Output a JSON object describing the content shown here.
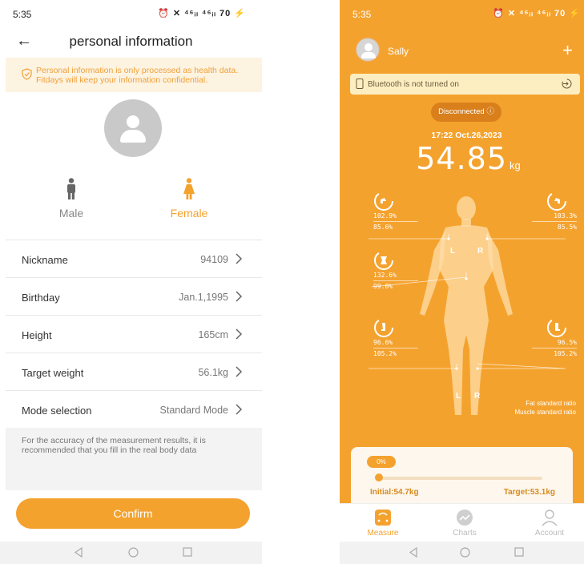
{
  "left": {
    "status_time": "5:35",
    "status_icons": "⏰ ✕ ⁴⁶ᵢₗ ⁴⁶ᵢₗ 70 ⚡",
    "title": "personal information",
    "notice": "Personal information is only processed as health data. Fitdays will keep your information confidential.",
    "gender": {
      "male": "Male",
      "female": "Female",
      "selected": "Female"
    },
    "rows": [
      {
        "label": "Nickname",
        "value": "94109"
      },
      {
        "label": "Birthday",
        "value": "Jan.1,1995"
      },
      {
        "label": "Height",
        "value": "165cm"
      },
      {
        "label": "Target weight",
        "value": "56.1kg"
      },
      {
        "label": "Mode selection",
        "value": "Standard Mode"
      }
    ],
    "tip": "For the accuracy of the measurement results, it is recommended that you fill in the real body data",
    "confirm": "Confirm"
  },
  "right": {
    "status_time": "5:35",
    "status_icons": "⏰ ✕ ⁴⁶ᵢₗ ⁴⁶ᵢₗ 70 ⚡",
    "user_name": "Sally",
    "bluetooth_notice": "Bluetooth is not turned on",
    "connection_status": "Disconnected ⓘ",
    "measure_time": "17:22 Oct.26,2023",
    "weight_value": "54.85",
    "weight_unit": "kg",
    "segments": {
      "left_arm": {
        "fat": "102.9%",
        "muscle": "85.6%"
      },
      "right_arm": {
        "fat": "103.3%",
        "muscle": "85.5%"
      },
      "trunk": {
        "fat": "132.6%",
        "muscle": "99.0%"
      },
      "left_leg": {
        "fat": "96.6%",
        "muscle": "105.2%"
      },
      "right_leg": {
        "fat": "96.5%",
        "muscle": "105.2%"
      }
    },
    "side_labels": {
      "left": "L",
      "right": "R"
    },
    "legend": {
      "fat": "Fat standard ratio",
      "muscle": "Muscle standard ratio"
    },
    "progress": {
      "percent_label": "0%",
      "fraction": 0.0,
      "initial": "Initial:54.7kg",
      "target": "Target:53.1kg"
    },
    "tabs": [
      {
        "label": "Measure",
        "active": true
      },
      {
        "label": "Charts",
        "active": false
      },
      {
        "label": "Account",
        "active": false
      }
    ],
    "colors": {
      "accent": "#f4a22e",
      "background": "#f4a22e",
      "notice_bg": "#fdeec2"
    }
  }
}
